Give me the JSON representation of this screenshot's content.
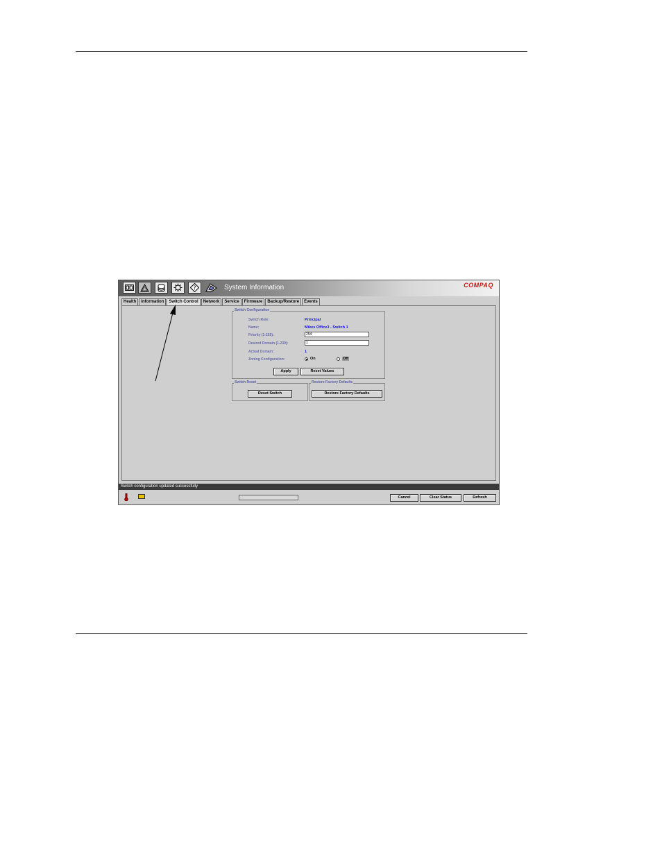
{
  "window": {
    "title": "System Information",
    "brand": "COMPAQ",
    "toolbar_icons": [
      "switch-view-icon",
      "zone-admin-icon",
      "fabric-icon",
      "switch-admin-icon",
      "help-icon",
      "logo-icon"
    ]
  },
  "tabs": [
    {
      "label": "Health",
      "active": false
    },
    {
      "label": "Information",
      "active": false
    },
    {
      "label": "Switch Control",
      "active": true
    },
    {
      "label": "Network",
      "active": false
    },
    {
      "label": "Service",
      "active": false
    },
    {
      "label": "Firmware",
      "active": false
    },
    {
      "label": "Backup/Restore",
      "active": false
    },
    {
      "label": "Events",
      "active": false
    }
  ],
  "switch_config": {
    "title": "Switch Configuration",
    "role_label": "Switch Role:",
    "role_value": "Principal",
    "name_label": "Name:",
    "name_value": "Mikes Office3 - Switch 1",
    "priority_label": "Priority (1-255):",
    "priority_value": "254",
    "domain_label": "Desired Domain (1-239):",
    "domain_value": "1",
    "actual_label": "Actual Domain:",
    "actual_value": "1",
    "zoning_label": "Zoning Configuration:",
    "zoning_on": "On",
    "zoning_off": "Off",
    "zoning_selected": "On",
    "apply": "Apply",
    "reset_values": "Reset Values"
  },
  "switch_reset": {
    "title": "Switch Reset",
    "button": "Reset Switch"
  },
  "factory": {
    "title": "Restore Factory Defaults",
    "button": "Restore Factory Defaults"
  },
  "status": {
    "message": "Switch configuration updated successfully",
    "cancel": "Cancel",
    "clear_status": "Clear Status",
    "refresh": "Refresh"
  },
  "colors": {
    "label": "#6b6baa",
    "value": "#1a1adc",
    "brand": "#d01818"
  }
}
